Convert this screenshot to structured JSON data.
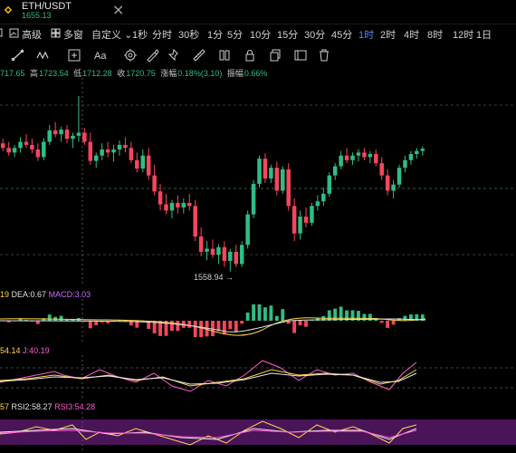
{
  "tab": {
    "title": "ETH/USDT",
    "subtitle": "1655.13",
    "close_glyph": "×",
    "icon": "binance-logo-icon"
  },
  "toolbar": {
    "chart_switch_icon": "candles-icon",
    "advanced_label": "高级",
    "multi_window_label": "多窗",
    "custom_label": "自定义",
    "intervals": [
      "1秒",
      "分时",
      "30秒",
      "1分",
      "5分",
      "10分",
      "15分",
      "30分",
      "45分",
      "1时",
      "2时",
      "4时",
      "8时",
      "12时",
      "1日"
    ],
    "active_interval": "1时"
  },
  "draw_tools": [
    "trend-line-icon",
    "pattern-icon",
    "add-indicator-icon",
    "text-icon",
    "settings-icon",
    "brush-icon",
    "pin-icon",
    "copy-icon",
    "lock-icon",
    "hide-icon",
    "delete-icon"
  ],
  "ohlc": {
    "open_value": "717.65",
    "high_label": "高",
    "high_value": "1723.54",
    "low_label": "低",
    "low_value": "1712.28",
    "close_label": "收",
    "close_value": "1720.75",
    "change_label": "涨幅",
    "change_value": "0.18%(3.10)",
    "amplitude_label": "振幅",
    "amplitude_value": "0.66%"
  },
  "price_annotation": "1558.94 →",
  "macd": {
    "dif": "19",
    "dea_label": "DEA:",
    "dea_value": "0.67",
    "macd_label": "MACD:",
    "macd_value": "3.03"
  },
  "kdj": {
    "d_label": "54.14",
    "j_label": "J:",
    "j_value": "40.19"
  },
  "rsi": {
    "rsi1": "57",
    "rsi2_label": "RSI2:",
    "rsi2_value": "58.27",
    "rsi3_label": "RSI3:",
    "rsi3_value": "54.28"
  },
  "colors": {
    "up": "#2ebd85",
    "down": "#f6465d",
    "accent": "#4f8cff",
    "macd_line": "#ffd54a",
    "rsi_band": "#5a1a6e"
  },
  "chart_data": {
    "type": "candlestick",
    "title": "",
    "low_marker": 1558.94,
    "candles": [
      [
        1728,
        1734,
        1718,
        1722
      ],
      [
        1722,
        1730,
        1712,
        1716
      ],
      [
        1716,
        1726,
        1710,
        1722
      ],
      [
        1722,
        1736,
        1716,
        1730
      ],
      [
        1730,
        1740,
        1722,
        1726
      ],
      [
        1726,
        1734,
        1715,
        1720
      ],
      [
        1720,
        1728,
        1705,
        1710
      ],
      [
        1710,
        1735,
        1706,
        1730
      ],
      [
        1730,
        1752,
        1726,
        1745
      ],
      [
        1745,
        1756,
        1736,
        1740
      ],
      [
        1740,
        1750,
        1730,
        1746
      ],
      [
        1746,
        1752,
        1728,
        1734
      ],
      [
        1734,
        1742,
        1722,
        1738
      ],
      [
        1738,
        1790,
        1730,
        1742
      ],
      [
        1742,
        1748,
        1726,
        1730
      ],
      [
        1730,
        1742,
        1700,
        1705
      ],
      [
        1705,
        1716,
        1696,
        1712
      ],
      [
        1712,
        1728,
        1706,
        1720
      ],
      [
        1720,
        1730,
        1710,
        1716
      ],
      [
        1716,
        1726,
        1704,
        1720
      ],
      [
        1720,
        1732,
        1712,
        1726
      ],
      [
        1726,
        1736,
        1716,
        1722
      ],
      [
        1722,
        1730,
        1702,
        1706
      ],
      [
        1706,
        1716,
        1690,
        1695
      ],
      [
        1695,
        1720,
        1690,
        1712
      ],
      [
        1712,
        1722,
        1680,
        1686
      ],
      [
        1686,
        1700,
        1660,
        1665
      ],
      [
        1665,
        1675,
        1640,
        1648
      ],
      [
        1648,
        1662,
        1635,
        1640
      ],
      [
        1640,
        1654,
        1630,
        1650
      ],
      [
        1650,
        1660,
        1636,
        1644
      ],
      [
        1644,
        1656,
        1636,
        1650
      ],
      [
        1650,
        1662,
        1640,
        1646
      ],
      [
        1646,
        1654,
        1600,
        1606
      ],
      [
        1606,
        1618,
        1580,
        1586
      ],
      [
        1586,
        1600,
        1575,
        1590
      ],
      [
        1590,
        1602,
        1578,
        1582
      ],
      [
        1582,
        1596,
        1570,
        1592
      ],
      [
        1592,
        1600,
        1566,
        1574
      ],
      [
        1574,
        1590,
        1560,
        1586
      ],
      [
        1586,
        1595,
        1566,
        1570
      ],
      [
        1570,
        1600,
        1566,
        1595
      ],
      [
        1595,
        1640,
        1590,
        1635
      ],
      [
        1635,
        1680,
        1630,
        1675
      ],
      [
        1675,
        1712,
        1670,
        1708
      ],
      [
        1708,
        1715,
        1676,
        1682
      ],
      [
        1682,
        1700,
        1676,
        1696
      ],
      [
        1696,
        1704,
        1660,
        1666
      ],
      [
        1666,
        1698,
        1662,
        1694
      ],
      [
        1694,
        1702,
        1640,
        1646
      ],
      [
        1646,
        1656,
        1600,
        1610
      ],
      [
        1610,
        1640,
        1602,
        1632
      ],
      [
        1632,
        1644,
        1618,
        1624
      ],
      [
        1624,
        1650,
        1620,
        1646
      ],
      [
        1646,
        1660,
        1640,
        1652
      ],
      [
        1652,
        1670,
        1646,
        1662
      ],
      [
        1662,
        1690,
        1658,
        1686
      ],
      [
        1686,
        1702,
        1680,
        1698
      ],
      [
        1698,
        1718,
        1694,
        1712
      ],
      [
        1712,
        1722,
        1702,
        1706
      ],
      [
        1706,
        1716,
        1700,
        1712
      ],
      [
        1712,
        1720,
        1704,
        1716
      ],
      [
        1716,
        1722,
        1706,
        1710
      ],
      [
        1710,
        1718,
        1702,
        1714
      ],
      [
        1714,
        1720,
        1698,
        1702
      ],
      [
        1702,
        1710,
        1680,
        1686
      ],
      [
        1686,
        1694,
        1660,
        1666
      ],
      [
        1666,
        1680,
        1656,
        1674
      ],
      [
        1674,
        1700,
        1670,
        1696
      ],
      [
        1696,
        1712,
        1690,
        1706
      ],
      [
        1706,
        1718,
        1700,
        1714
      ],
      [
        1714,
        1722,
        1708,
        1718
      ],
      [
        1718,
        1724,
        1712,
        1721
      ]
    ]
  }
}
